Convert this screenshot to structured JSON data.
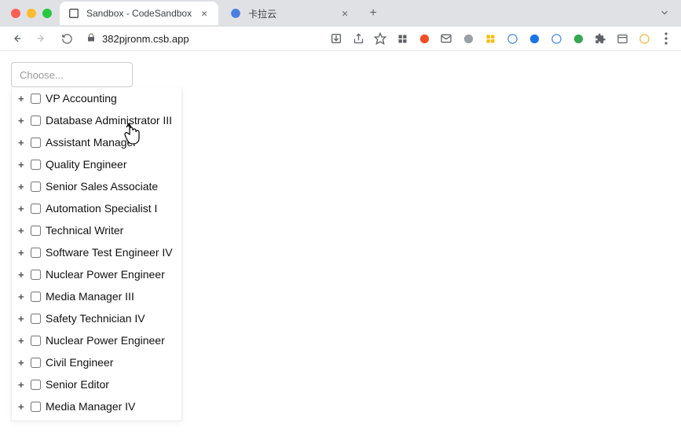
{
  "browser": {
    "tabs": [
      {
        "title": "Sandbox - CodeSandbox",
        "favicon": "codesandbox",
        "active": true
      },
      {
        "title": "卡拉云",
        "favicon": "blue-circle",
        "active": false
      }
    ],
    "url": "382pjronm.csb.app"
  },
  "combobox": {
    "placeholder": "Choose...",
    "value": "",
    "options": [
      "VP Accounting",
      "Database Administrator III",
      "Assistant Manager",
      "Quality Engineer",
      "Senior Sales Associate",
      "Automation Specialist I",
      "Technical Writer",
      "Software Test Engineer IV",
      "Nuclear Power Engineer",
      "Media Manager III",
      "Safety Technician IV",
      "Nuclear Power Engineer",
      "Civil Engineer",
      "Senior Editor",
      "Media Manager IV"
    ]
  }
}
